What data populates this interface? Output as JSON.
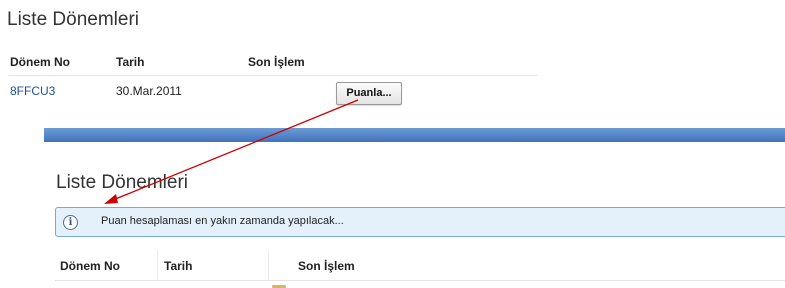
{
  "top_panel": {
    "title": "Liste Dönemleri",
    "headers": {
      "period_no": "Dönem No",
      "date": "Tarih",
      "last_action": "Son İşlem"
    },
    "row": {
      "period_no": "8FFCU3",
      "date": "30.Mar.2011",
      "button_label": "Puanla..."
    }
  },
  "bottom_panel": {
    "title": "Liste Dönemleri",
    "info_icon": "info-icon",
    "info_text": "Puan hesaplaması en yakın zamanda yapılacak...",
    "headers": {
      "period_no": "Dönem No",
      "date": "Tarih",
      "last_action": "Son İşlem"
    }
  },
  "colors": {
    "link": "#1f4f9a",
    "band": "#3f73bd",
    "info_background": "#e5f1fa",
    "info_border": "#7aa9d3",
    "annotation_arrow": "#cc0000"
  }
}
